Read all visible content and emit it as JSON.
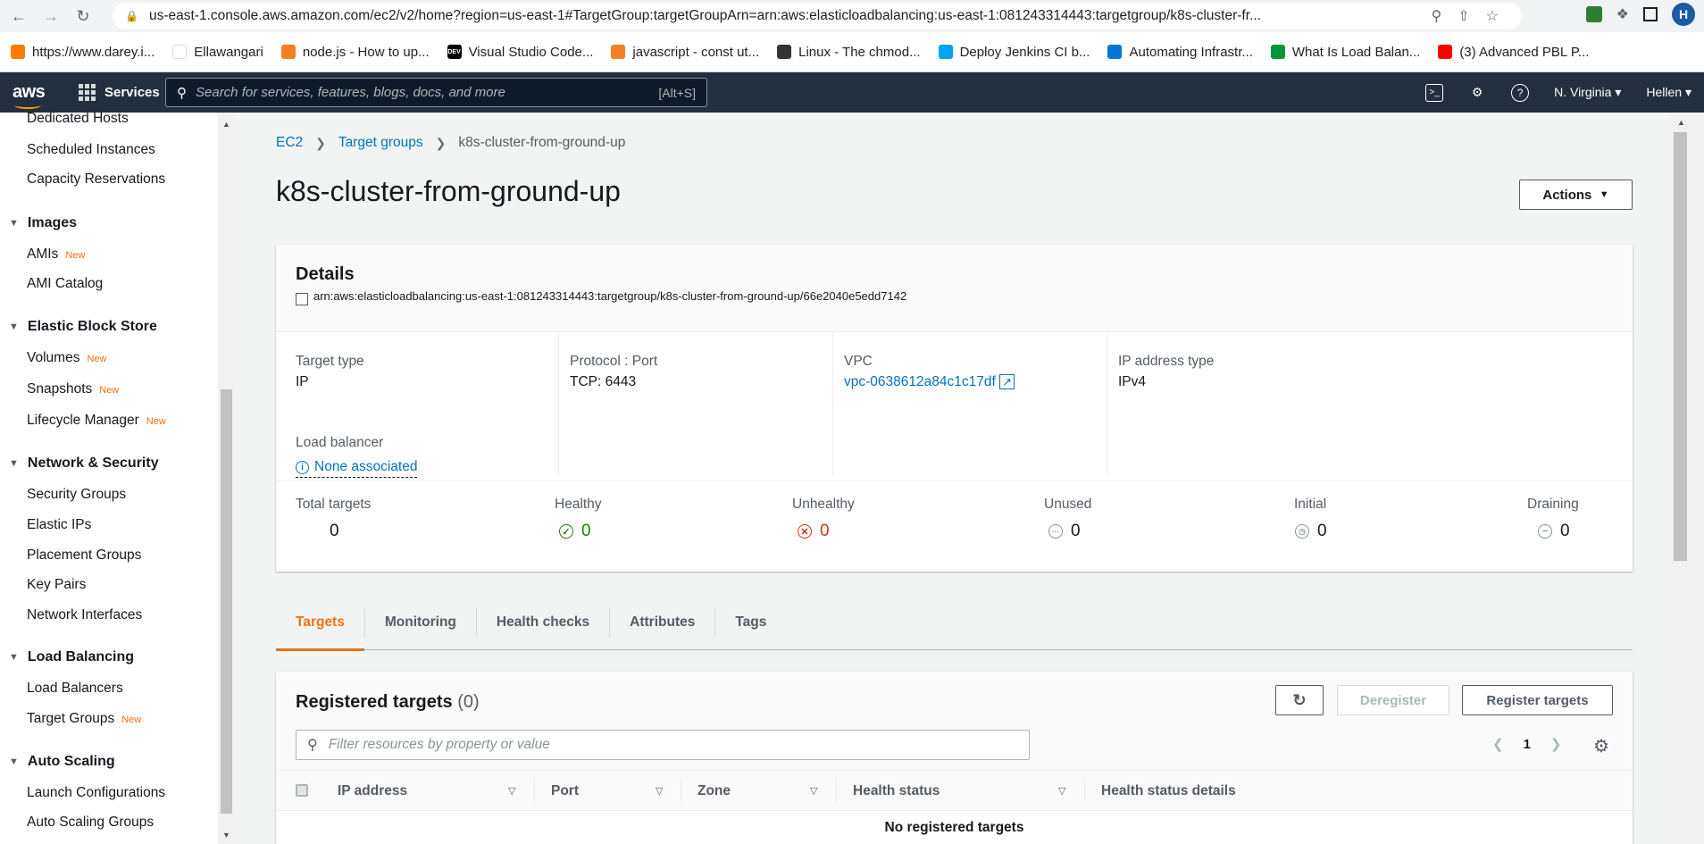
{
  "browser": {
    "url": "us-east-1.console.aws.amazon.com/ec2/v2/home?region=us-east-1#TargetGroup:targetGroupArn=arn:aws:elasticloadbalancing:us-east-1:081243314443:targetgroup/k8s-cluster-fr...",
    "profile_initial": "H",
    "bookmarks": [
      {
        "label": "https://www.darey.i...",
        "color": "#ff7a00"
      },
      {
        "label": "Ellawangari",
        "color": "#ffffff"
      },
      {
        "label": "node.js - How to up...",
        "color": "#f48024"
      },
      {
        "label": "Visual Studio Code...",
        "color": "#000000",
        "tag": "DEV"
      },
      {
        "label": "javascript - const ut...",
        "color": "#f48024"
      },
      {
        "label": "Linux - The chmod...",
        "color": "#333333"
      },
      {
        "label": "Deploy Jenkins CI b...",
        "color": "#00a4ef"
      },
      {
        "label": "Automating Infrastr...",
        "color": "#0078d4"
      },
      {
        "label": "What Is Load Balan...",
        "color": "#009639"
      },
      {
        "label": "(3) Advanced PBL P...",
        "color": "#ff0000"
      }
    ]
  },
  "aws_nav": {
    "logo": "aws",
    "services": "Services",
    "search_placeholder": "Search for services, features, blogs, docs, and more",
    "search_shortcut": "[Alt+S]",
    "region": "N. Virginia",
    "user": "Hellen"
  },
  "sidebar": {
    "items": [
      {
        "label": "Dedicated Hosts"
      },
      {
        "label": "Scheduled Instances"
      },
      {
        "label": "Capacity Reservations"
      }
    ],
    "images": {
      "title": "Images",
      "items": [
        {
          "label": "AMIs",
          "badge": "New"
        },
        {
          "label": "AMI Catalog"
        }
      ]
    },
    "ebs": {
      "title": "Elastic Block Store",
      "items": [
        {
          "label": "Volumes",
          "badge": "New"
        },
        {
          "label": "Snapshots",
          "badge": "New"
        },
        {
          "label": "Lifecycle Manager",
          "badge": "New"
        }
      ]
    },
    "netsec": {
      "title": "Network & Security",
      "items": [
        {
          "label": "Security Groups"
        },
        {
          "label": "Elastic IPs"
        },
        {
          "label": "Placement Groups"
        },
        {
          "label": "Key Pairs"
        },
        {
          "label": "Network Interfaces"
        }
      ]
    },
    "lb": {
      "title": "Load Balancing",
      "items": [
        {
          "label": "Load Balancers"
        },
        {
          "label": "Target Groups",
          "badge": "New"
        }
      ]
    },
    "as": {
      "title": "Auto Scaling",
      "items": [
        {
          "label": "Launch Configurations"
        },
        {
          "label": "Auto Scaling Groups"
        }
      ]
    }
  },
  "breadcrumb": {
    "ec2": "EC2",
    "target_groups": "Target groups",
    "current": "k8s-cluster-from-ground-up"
  },
  "page_title": "k8s-cluster-from-ground-up",
  "actions_label": "Actions",
  "details": {
    "title": "Details",
    "arn": "arn:aws:elasticloadbalancing:us-east-1:081243314443:targetgroup/k8s-cluster-from-ground-up/66e2040e5edd7142",
    "target_type_label": "Target type",
    "target_type": "IP",
    "protocol_label": "Protocol : Port",
    "protocol": "TCP: 6443",
    "vpc_label": "VPC",
    "vpc": "vpc-0638612a84c1c17df",
    "ip_type_label": "IP address type",
    "ip_type": "IPv4",
    "lb_label": "Load balancer",
    "lb_value": "None associated",
    "stats": {
      "total_label": "Total targets",
      "total": "0",
      "healthy_label": "Healthy",
      "healthy": "0",
      "unhealthy_label": "Unhealthy",
      "unhealthy": "0",
      "unused_label": "Unused",
      "unused": "0",
      "initial_label": "Initial",
      "initial": "0",
      "draining_label": "Draining",
      "draining": "0"
    }
  },
  "tabs": [
    "Targets",
    "Monitoring",
    "Health checks",
    "Attributes",
    "Tags"
  ],
  "registered": {
    "title": "Registered targets",
    "count": "(0)",
    "deregister": "Deregister",
    "register": "Register targets",
    "filter_placeholder": "Filter resources by property or value",
    "page": "1",
    "columns": [
      "IP address",
      "Port",
      "Zone",
      "Health status",
      "Health status details"
    ],
    "empty": "No registered targets"
  },
  "colors": {
    "accent": "#ec7211",
    "link": "#0073bb",
    "healthy": "#1d8102",
    "unhealthy": "#d13212",
    "nav": "#232f3e"
  }
}
